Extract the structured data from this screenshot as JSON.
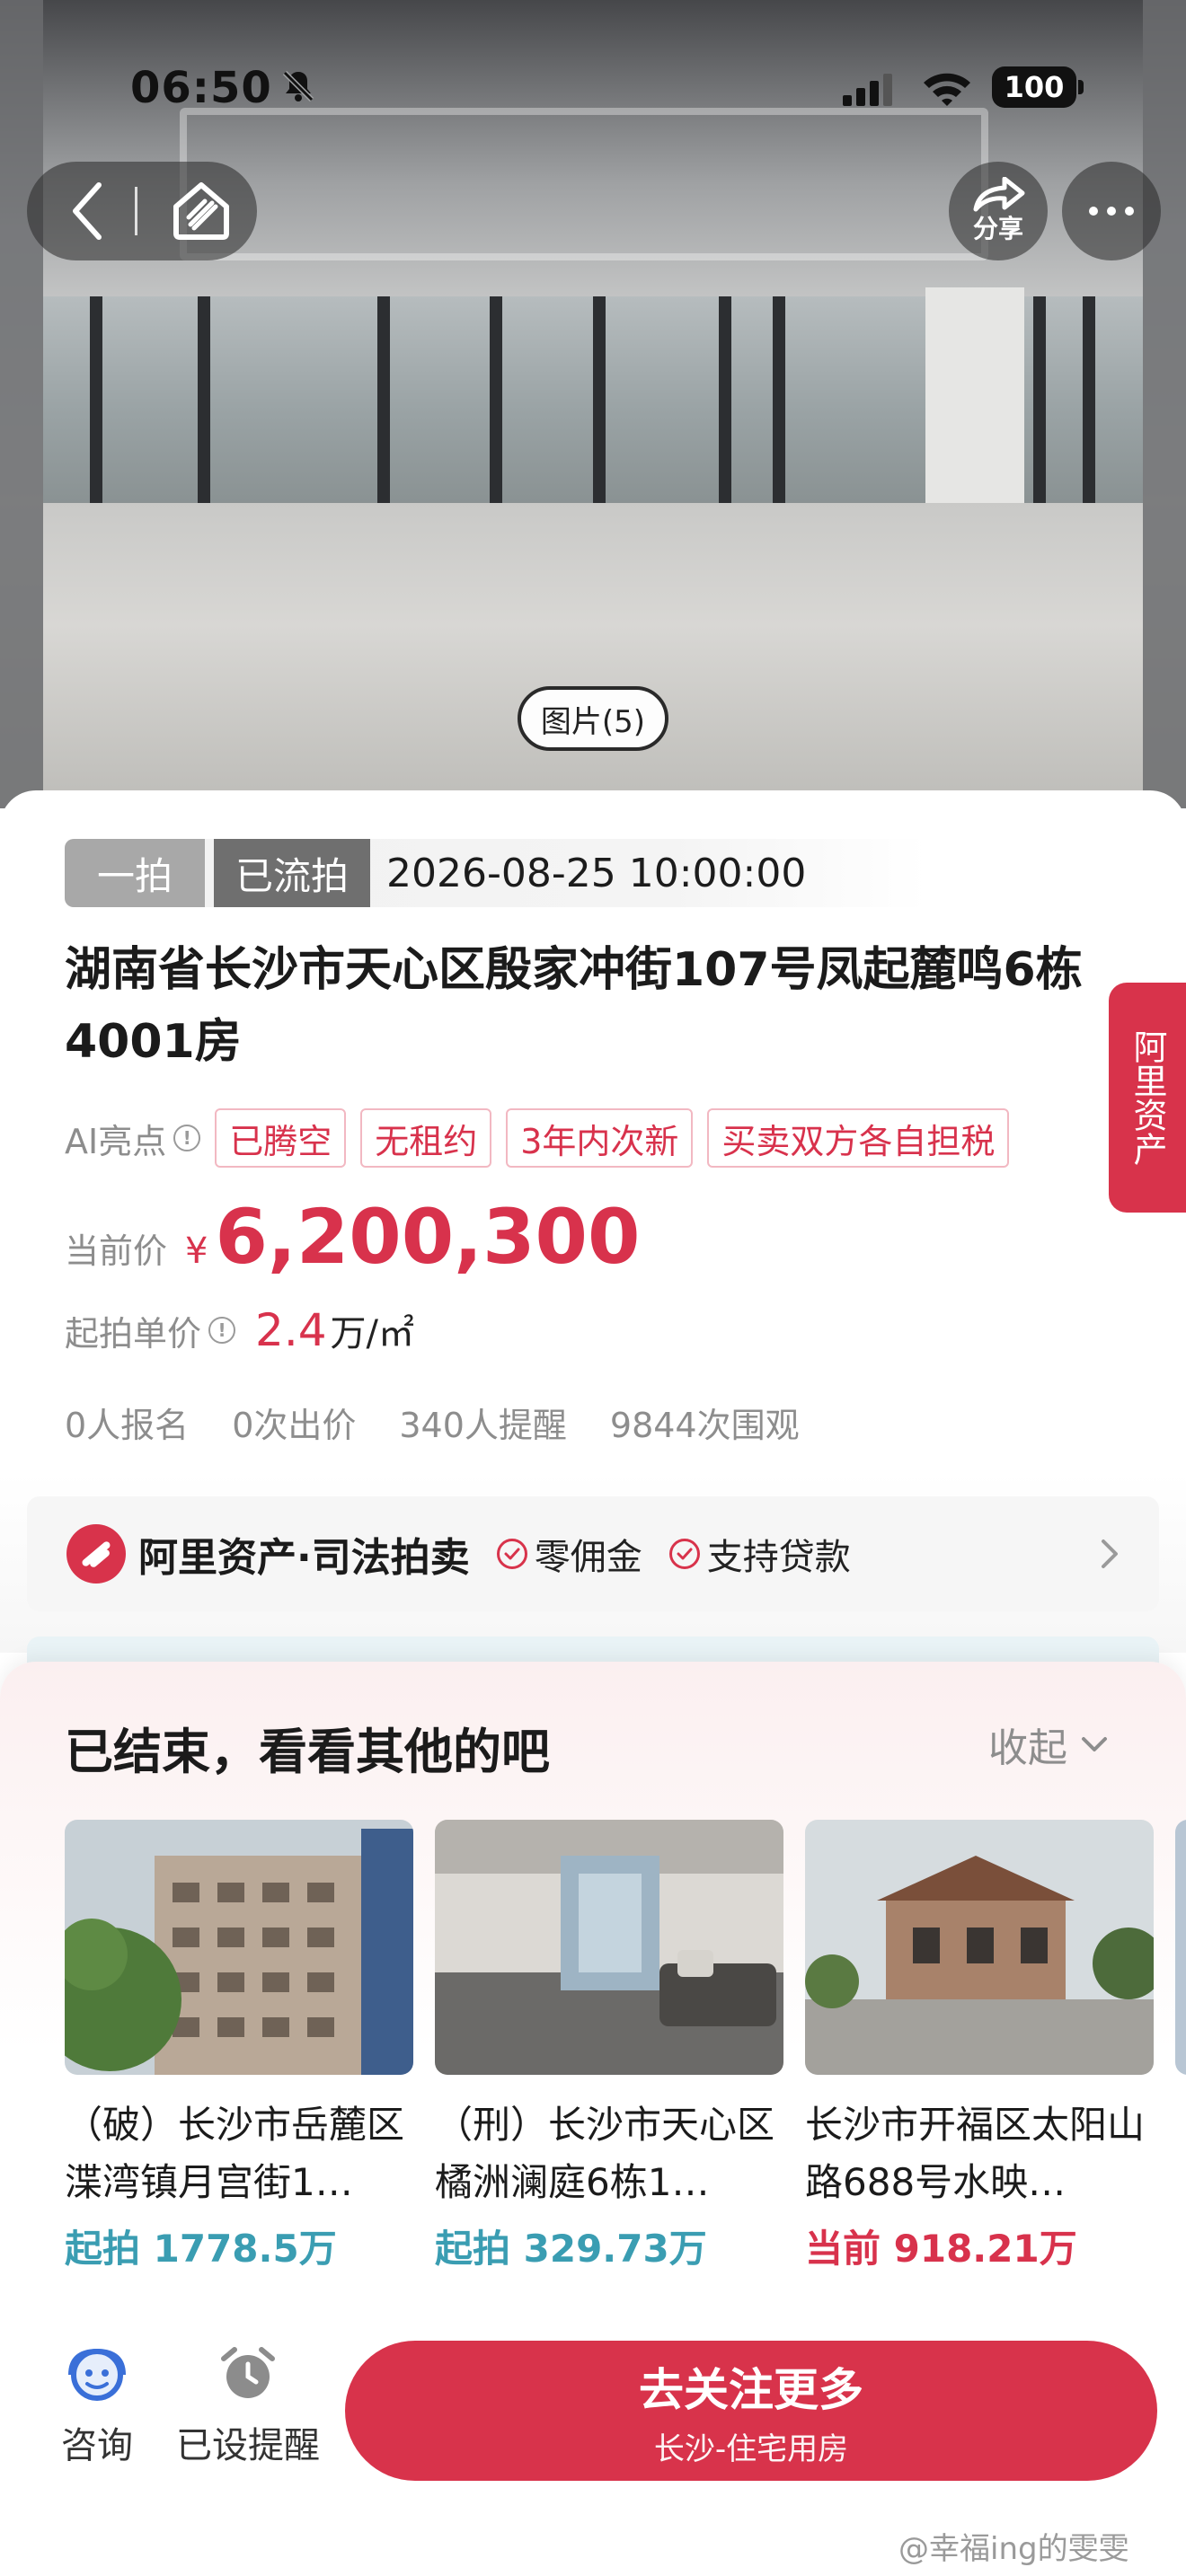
{
  "status_bar": {
    "time": "06:50",
    "battery": "100"
  },
  "top_nav": {
    "share_label": "分享",
    "photo_count": "图片(5)"
  },
  "auction": {
    "round": "一拍",
    "status": "已流拍",
    "datetime": "2026-08-25 10:00:00",
    "title": "湖南省长沙市天心区殷家冲街107号凤起麓鸣6栋4001房",
    "ai_label": "AI亮点",
    "ai_tags": [
      "已腾空",
      "无租约",
      "3年内次新",
      "买卖双方各自担税"
    ],
    "price_label": "当前价",
    "currency": "¥",
    "price": "6,200,300",
    "unit_price_label": "起拍单价",
    "unit_price": "2.4",
    "unit_price_suffix": "万/㎡",
    "stats": [
      "0人报名",
      "0次出价",
      "340人提醒",
      "9844次围观"
    ]
  },
  "side_badge": {
    "label": "阿里资产"
  },
  "banner": {
    "brand": "阿里资产·司法拍卖",
    "feature1": "零佣金",
    "feature2": "支持贷款"
  },
  "sheet": {
    "title": "已结束，看看其他的吧",
    "collapse_label": "收起",
    "cards": [
      {
        "title": "（破）长沙市岳麓区渫湾镇月宫街1…",
        "price": "起拍 1778.5万"
      },
      {
        "title": "（刑）长沙市天心区橘洲澜庭6栋1…",
        "price": "起拍 329.73万"
      },
      {
        "title": "长沙市开福区太阳山路688号水映…",
        "price": "当前 918.21万"
      }
    ]
  },
  "bottom_bar": {
    "consult_label": "咨询",
    "remind_label": "已设提醒",
    "follow_label": "去关注更多",
    "follow_sub": "长沙-住宅用房"
  },
  "watermark": "@幸福ing的雯雯",
  "colors": {
    "accent": "#d8334b",
    "teal_price": "#3a9db2",
    "tag_gray": "#a8a8a8"
  }
}
